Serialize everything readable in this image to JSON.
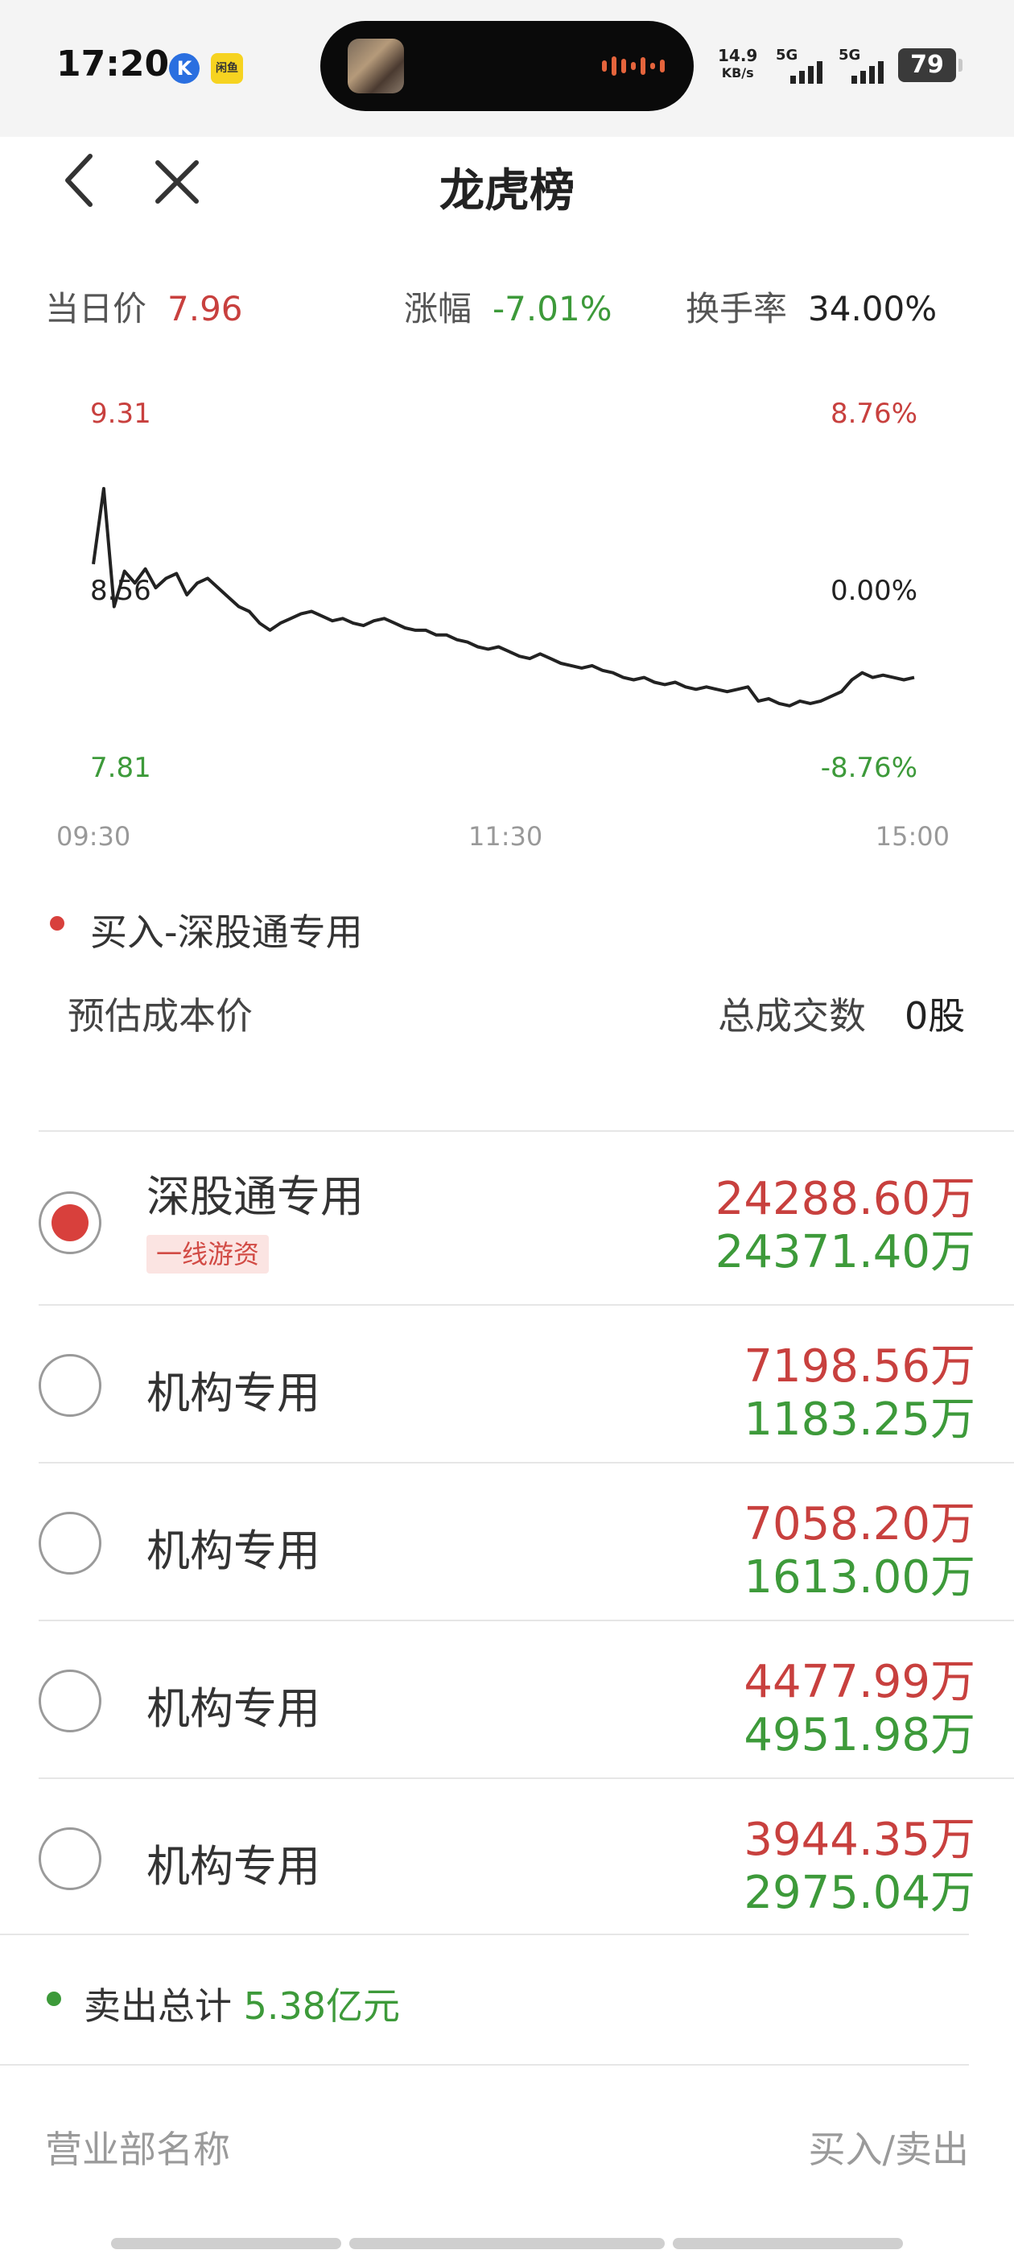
{
  "status_bar": {
    "time": "17:20",
    "app_icon_k": "K",
    "app_icon_y": "闲鱼",
    "net_speed_value": "14.9",
    "net_speed_unit": "KB/s",
    "signal1_label": "5G",
    "signal2_label": "5G",
    "battery": "79"
  },
  "nav": {
    "title": "龙虎榜",
    "back_icon": "chevron-left-icon",
    "close_icon": "close-icon"
  },
  "quote": {
    "price_label": "当日价",
    "price_value": "7.96",
    "change_label": "涨幅",
    "change_value": "-7.01%",
    "turnover_label": "换手率",
    "turnover_value": "34.00%"
  },
  "chart_data": {
    "type": "line",
    "y_left_ticks": [
      "9.31",
      "8.56",
      "7.81"
    ],
    "y_right_ticks": [
      "8.76%",
      "0.00%",
      "-8.76%"
    ],
    "x_ticks": [
      "09:30",
      "11:30",
      "15:00"
    ],
    "ylim": [
      7.81,
      9.31
    ],
    "series": [
      {
        "values": [
          8.68,
          9.0,
          8.5,
          8.65,
          8.6,
          8.66,
          8.58,
          8.62,
          8.64,
          8.55,
          8.6,
          8.62,
          8.58,
          8.54,
          8.5,
          8.48,
          8.43,
          8.4,
          8.43,
          8.45,
          8.47,
          8.48,
          8.46,
          8.44,
          8.45,
          8.43,
          8.42,
          8.44,
          8.45,
          8.43,
          8.41,
          8.4,
          8.4,
          8.38,
          8.38,
          8.36,
          8.35,
          8.33,
          8.32,
          8.33,
          8.31,
          8.29,
          8.28,
          8.3,
          8.28,
          8.26,
          8.25,
          8.24,
          8.25,
          8.23,
          8.22,
          8.2,
          8.19,
          8.2,
          8.18,
          8.17,
          8.18,
          8.16,
          8.15,
          8.16,
          8.15,
          8.14,
          8.15,
          8.16,
          8.1,
          8.11,
          8.09,
          8.08,
          8.1,
          8.09,
          8.1,
          8.12,
          8.14,
          8.19,
          8.22,
          8.2,
          8.21,
          8.2,
          8.19,
          8.2
        ]
      }
    ]
  },
  "buy_section": {
    "title": "买入-深股通专用",
    "est_cost_label": "预估成本价",
    "total_volume_label": "总成交数",
    "total_volume_value": "0股"
  },
  "seats": [
    {
      "name": "深股通专用",
      "tag": "一线游资",
      "buy": "24288.60万",
      "sell": "24371.40万",
      "selected": true
    },
    {
      "name": "机构专用",
      "tag": "",
      "buy": "7198.56万",
      "sell": "1183.25万",
      "selected": false
    },
    {
      "name": "机构专用",
      "tag": "",
      "buy": "7058.20万",
      "sell": "1613.00万",
      "selected": false
    },
    {
      "name": "机构专用",
      "tag": "",
      "buy": "4477.99万",
      "sell": "4951.98万",
      "selected": false
    },
    {
      "name": "机构专用",
      "tag": "",
      "buy": "3944.35万",
      "sell": "2975.04万",
      "selected": false
    }
  ],
  "sell_section": {
    "label": "卖出总计",
    "value": "5.38亿元"
  },
  "footer_header": {
    "branch_label": "营业部名称",
    "buy_sell_label": "买入/卖出"
  },
  "colors": {
    "up": "#c8403e",
    "down": "#3d9a3a",
    "line": "#222222"
  }
}
